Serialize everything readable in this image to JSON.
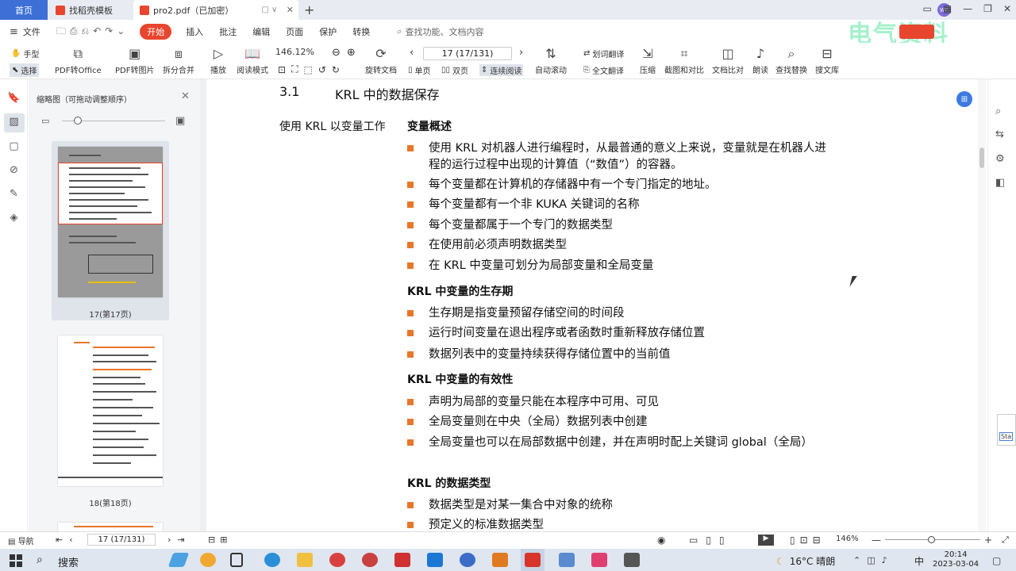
{
  "tabs": {
    "home": "首页",
    "template": "找稻壳模板",
    "doc": "pro2.pdf（已加密）",
    "mini": "□ ∨"
  },
  "watermark": "电气资料",
  "avatar": "WP",
  "menu": {
    "file": "文件",
    "start": "开始",
    "items": [
      "插入",
      "批注",
      "编辑",
      "页面",
      "保护",
      "转换"
    ],
    "search": "查找功能、文档内容"
  },
  "toolbar": {
    "hand": "手型",
    "select": "选择",
    "pdf_office": "PDF转Office",
    "pdf_image": "PDF转图片",
    "split_merge": "拆分合并",
    "play": "播放",
    "read_mode": "阅读模式",
    "zoom": "146.12%",
    "rotate": "旋转文档",
    "page_value": "17 (17/131)",
    "single": "单页",
    "double": "双页",
    "continuous": "连续阅读",
    "auto_scroll": "自动滚动",
    "translate_line": "划词翻译",
    "translate_full": "全文翻译",
    "compress": "压缩",
    "screenshot": "截图和对比",
    "compare": "文档比对",
    "read_aloud": "朗读",
    "find_replace": "查找替换",
    "library": "搜文库"
  },
  "thumbs": {
    "title": "缩略图（可拖动调整顺序）",
    "page17": "17(第17页)",
    "page18": "18(第18页)"
  },
  "doc": {
    "section_no": "3.1",
    "section_title": "KRL 中的数据保存",
    "sidenote": "使用 KRL 以变量工作",
    "h1": "变量概述",
    "b1": [
      "使用 KRL 对机器人进行编程时，从最普通的意义上来说，变量就是在机器人进程的运行过程中出现的计算值（“数值”）的容器。",
      "每个变量都在计算机的存储器中有一个专门指定的地址。",
      "每个变量都有一个非 KUKA 关键词的名称",
      "每个变量都属于一个专门的数据类型",
      "在使用前必须声明数据类型",
      "在 KRL 中变量可划分为局部变量和全局变量"
    ],
    "h2": "KRL 中变量的生存期",
    "b2": [
      "生存期是指变量预留存储空间的时间段",
      "运行时间变量在退出程序或者函数时重新释放存储位置",
      "数据列表中的变量持续获得存储位置中的当前值"
    ],
    "h3": "KRL 中变量的有效性",
    "b3": [
      "声明为局部的变量只能在本程序中可用、可见",
      "全局变量则在中央（全局）数据列表中创建",
      "全局变量也可以在局部数据中创建，并在声明时配上关键词 global（全局）"
    ],
    "h4": "KRL 的数据类型",
    "b4": [
      "数据类型是对某一集合中对象的统称",
      "预定义的标准数据类型"
    ]
  },
  "status": {
    "nav": "导航",
    "page": "17 (17/131)",
    "zoom": "146%"
  },
  "taskbar": {
    "search": "搜索",
    "weather": "16°C 晴朗",
    "ime": "中",
    "time": "20:14",
    "date": "2023-03-04"
  },
  "edge_popup": "Sta",
  "colors": {
    "accent": "#e8452e",
    "bullet": "#e8762b",
    "tab_home": "#3d6fd6"
  }
}
